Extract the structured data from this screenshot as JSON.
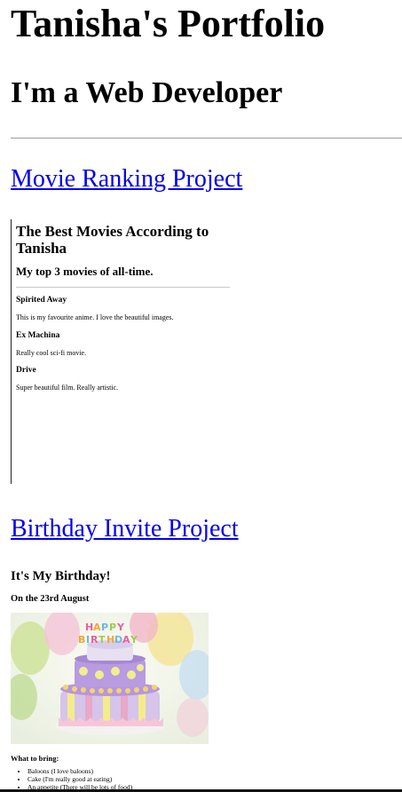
{
  "header": {
    "title": "Tanisha's Portfolio",
    "tagline": "I'm a Web Developer"
  },
  "projects": {
    "movie": {
      "link_label": "Movie Ranking Project",
      "embed": {
        "title": "The Best Movies According to Tanisha",
        "subtitle": "My top 3 movies of all-time.",
        "movies": [
          {
            "name": "Spirited Away",
            "desc": "This is my favourite anime. I love the beautiful images."
          },
          {
            "name": "Ex Machina",
            "desc": "Really cool sci-fi movie."
          },
          {
            "name": "Drive",
            "desc": "Super beautiful film. Really artistic."
          }
        ]
      }
    },
    "birthday": {
      "link_label": "Birthday Invite Project",
      "embed": {
        "title": "It's My Birthday!",
        "date": "On the 23rd August",
        "image_text": "HAPPY BIRTHDAY",
        "bring_heading": "What to bring:",
        "bring_items": [
          "Baloons (I love baloons)",
          "Cake (I'm really good at eating)",
          "An appetite (There will be lots of food)"
        ]
      }
    }
  },
  "colors": {
    "link": "#0000ee",
    "divider": "#9a9a9a"
  }
}
